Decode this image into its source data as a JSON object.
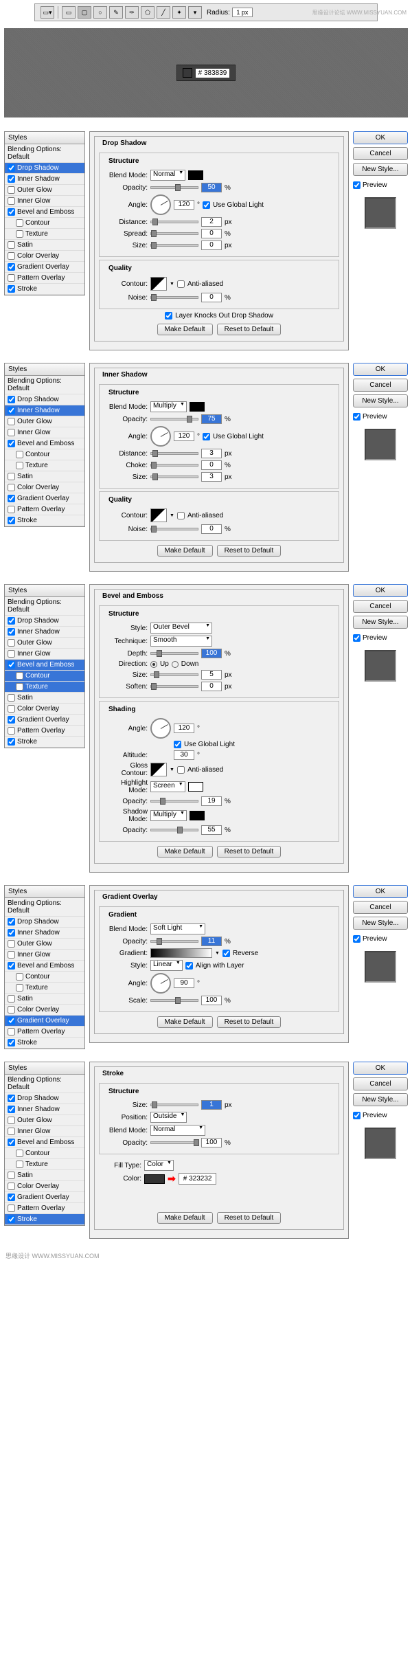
{
  "toolbar": {
    "radius_label": "Radius:",
    "radius_value": "1 px",
    "watermark": "思缘设计论坛 WWW.MISSYUAN.COM"
  },
  "hex": {
    "label": "#",
    "value": "383839"
  },
  "styles_header": "Styles",
  "blending_default": "Blending Options: Default",
  "style_names": {
    "drop_shadow": "Drop Shadow",
    "inner_shadow": "Inner Shadow",
    "outer_glow": "Outer Glow",
    "inner_glow": "Inner Glow",
    "bevel_emboss": "Bevel and Emboss",
    "contour": "Contour",
    "texture": "Texture",
    "satin": "Satin",
    "color_overlay": "Color Overlay",
    "gradient_overlay": "Gradient Overlay",
    "pattern_overlay": "Pattern Overlay",
    "stroke": "Stroke"
  },
  "buttons": {
    "ok": "OK",
    "cancel": "Cancel",
    "new_style": "New Style...",
    "preview": "Preview",
    "make_default": "Make Default",
    "reset_default": "Reset to Default"
  },
  "labels": {
    "blend_mode": "Blend Mode:",
    "opacity": "Opacity:",
    "angle": "Angle:",
    "distance": "Distance:",
    "spread": "Spread:",
    "size": "Size:",
    "choke": "Choke:",
    "contour": "Contour:",
    "noise": "Noise:",
    "use_global": "Use Global Light",
    "anti_aliased": "Anti-aliased",
    "layer_knocks": "Layer Knocks Out Drop Shadow",
    "structure": "Structure",
    "quality": "Quality",
    "shading": "Shading",
    "style": "Style:",
    "technique": "Technique:",
    "depth": "Depth:",
    "direction": "Direction:",
    "up": "Up",
    "down": "Down",
    "soften": "Soften:",
    "altitude": "Altitude:",
    "gloss_contour": "Gloss Contour:",
    "highlight_mode": "Highlight Mode:",
    "shadow_mode": "Shadow Mode:",
    "gradient": "Gradient:",
    "gradient_lbl": "Gradient",
    "reverse": "Reverse",
    "align_layer": "Align with Layer",
    "scale": "Scale:",
    "position": "Position:",
    "fill_type": "Fill Type:",
    "color": "Color:"
  },
  "units": {
    "pct": "%",
    "px": "px",
    "deg": "°"
  },
  "panels": {
    "drop_shadow": {
      "title": "Drop Shadow",
      "blend_mode": "Normal",
      "opacity": "50",
      "angle": "120",
      "distance": "2",
      "spread": "0",
      "size": "0",
      "noise": "0"
    },
    "inner_shadow": {
      "title": "Inner Shadow",
      "blend_mode": "Multiply",
      "opacity": "75",
      "angle": "120",
      "distance": "3",
      "choke": "0",
      "size": "3",
      "noise": "0"
    },
    "bevel": {
      "title": "Bevel and Emboss",
      "style": "Outer Bevel",
      "technique": "Smooth",
      "depth": "100",
      "size": "5",
      "soften": "0",
      "angle": "120",
      "altitude": "30",
      "highlight_mode": "Screen",
      "hl_opacity": "19",
      "shadow_mode": "Multiply",
      "sd_opacity": "55"
    },
    "gradient": {
      "title": "Gradient Overlay",
      "blend_mode": "Soft Light",
      "opacity": "11",
      "style": "Linear",
      "angle": "90",
      "scale": "100"
    },
    "stroke": {
      "title": "Stroke",
      "size": "1",
      "position": "Outside",
      "blend_mode": "Normal",
      "opacity": "100",
      "fill_type": "Color",
      "color_hex": "323232"
    }
  },
  "footer": "思缘设计 WWW.MISSYUAN.COM"
}
